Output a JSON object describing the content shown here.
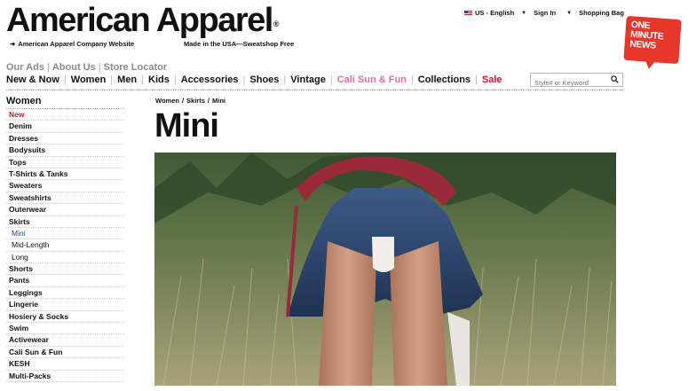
{
  "header": {
    "logo": "American Apparel",
    "logo_mark": "®",
    "tagline_left": "American Apparel Company Website",
    "tagline_mid": "Made in the USA—Sweatshop Free"
  },
  "topnav": {
    "country": "US - English",
    "signin": "Sign In",
    "bag": "Shopping Bag"
  },
  "badge": {
    "line1": "ONE",
    "line2": "MINUTE",
    "line3": "NEWS"
  },
  "subnav": [
    "Our Ads",
    "About Us",
    "Store Locator"
  ],
  "mainnav": [
    {
      "label": "New & Now",
      "color": "#111111"
    },
    {
      "label": "Women",
      "color": "#111111"
    },
    {
      "label": "Men",
      "color": "#111111"
    },
    {
      "label": "Kids",
      "color": "#111111"
    },
    {
      "label": "Accessories",
      "color": "#111111"
    },
    {
      "label": "Shoes",
      "color": "#111111"
    },
    {
      "label": "Vintage",
      "color": "#111111"
    },
    {
      "label": "Cali Sun & Fun",
      "color": "#e46ea3"
    },
    {
      "label": "Collections",
      "color": "#111111"
    },
    {
      "label": "Sale",
      "color": "#d3132b"
    }
  ],
  "search": {
    "placeholder": "Style# or Keyword"
  },
  "sidebar": {
    "heading": "Women",
    "items": [
      "New",
      "Denim",
      "Dresses",
      "Bodysuits",
      "Tops",
      "T-Shirts & Tanks",
      "Sweaters",
      "Sweatshirts",
      "Outerwear",
      "Skirts",
      "Mini",
      "Mid-Length",
      "Long",
      "Shorts",
      "Pants",
      "Leggings",
      "Lingerie",
      "Hosiery & Socks",
      "Swim",
      "Activewear",
      "Cali Sun & Fun",
      "KESH",
      "Multi-Packs"
    ]
  },
  "breadcrumb": [
    "Women",
    "Skirts",
    "Mini"
  ],
  "page_title": "Mini",
  "colors": {
    "accent_red": "#d3132b",
    "accent_pink": "#e46ea3",
    "badge_red": "#e8372a"
  }
}
